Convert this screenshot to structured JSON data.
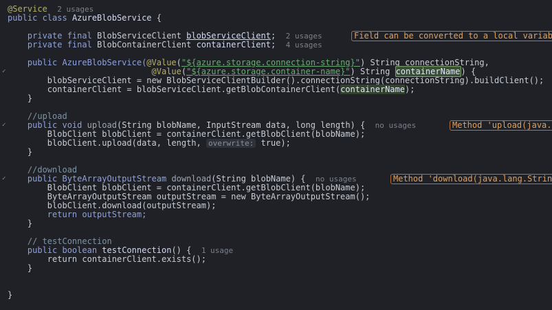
{
  "code": {
    "service_annotation": "@Service",
    "service_usages": "2 usages",
    "class_keyword": "public class",
    "class_name": "AzureBlobService",
    "open_brace": "{",
    "close_brace": "}",
    "field1": {
      "modifiers": "private final",
      "type": "BlobServiceClient",
      "name": "blobServiceClient",
      "usages": "2 usages",
      "warning": "Field can be converted to a local variable"
    },
    "field2": {
      "modifiers": "private final",
      "type": "BlobContainerClient",
      "name": "containerClient",
      "usages": "4 usages"
    },
    "ctor": {
      "sig_prefix": "public AzureBlobService(",
      "value1": "@Value",
      "str1": "\"${azure.storage.connection-string}\"",
      "param1": "String connectionString,",
      "value2": "@Value",
      "str2": "\"${azure.storage.container-name}\"",
      "param2_type": "String",
      "param2_name": "containerName",
      "sig_suffix": ") {",
      "line1": "blobServiceClient = new BlobServiceClientBuilder().connectionString(connectionString).buildClient();",
      "line2_prefix": "containerClient = blobServiceClient.getBlobContainerClient(",
      "line2_arg": "containerName",
      "line2_suffix": ");"
    },
    "upload": {
      "comment": "//upload",
      "sig_prefix": "public void",
      "name": "upload",
      "params": "(String blobName, InputStream data, long length) {",
      "usages": "no usages",
      "warning": "Method 'upload(java.lang.String, java.io.InputStream, long)' is never used",
      "line1": "BlobClient blobClient = containerClient.getBlobClient(blobName);",
      "line2_prefix": "blobClient.upload(data, length,",
      "line2_hint": "overwrite:",
      "line2_suffix": "true);"
    },
    "download": {
      "comment": "//download",
      "sig_prefix": "public ByteArrayOutputStream",
      "name": "download",
      "params": "(String blobName) {",
      "usages": "no usages",
      "warning": "Method 'download(java.lang.String)' is never used",
      "line1": "BlobClient blobClient = containerClient.getBlobClient(blobName);",
      "line2": "ByteArrayOutputStream outputStream = new ByteArrayOutputStream();",
      "line3": "blobClient.download(outputStream);",
      "line4": "return outputStream;"
    },
    "test": {
      "comment": "// testConnection",
      "sig_prefix": "public boolean",
      "name": "testConnection",
      "params": "() {",
      "usages": "1 usage",
      "line1": "return containerClient.exists();"
    }
  }
}
